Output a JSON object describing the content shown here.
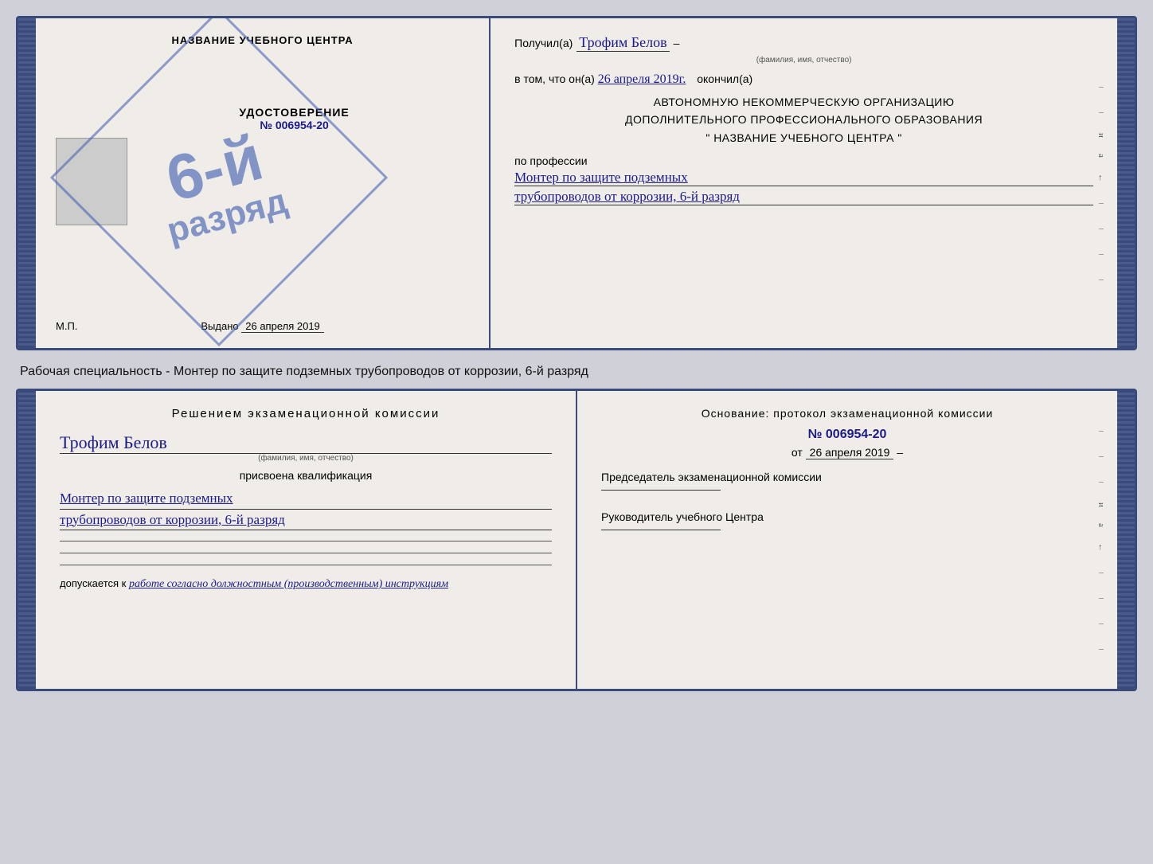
{
  "page": {
    "background": "#d0d0d8"
  },
  "top_certificate": {
    "left_page": {
      "institution_name": "НАЗВАНИЕ УЧЕБНОГО ЦЕНТРА",
      "udostoverenie_title": "УДОСТОВЕРЕНИЕ",
      "cert_number": "№ 006954-20",
      "stamp_lines": [
        "6-й",
        "разряд"
      ],
      "vydano_label": "Выдано",
      "vydano_date": "26 апреля 2019",
      "mp_label": "М.П."
    },
    "right_page": {
      "poluchil_label": "Получил(a)",
      "fio_value": "Трофим Белов",
      "fio_subtitle": "(фамилия, имя, отчество)",
      "dash": "–",
      "vtom_label": "в том, что он(а)",
      "date_value": "26 апреля 2019г.",
      "okonchil_label": "окончил(а)",
      "org_line1": "АВТОНОМНУЮ НЕКОММЕРЧЕСКУЮ ОРГАНИЗАЦИЮ",
      "org_line2": "ДОПОЛНИТЕЛЬНОГО ПРОФЕССИОНАЛЬНОГО ОБРАЗОВАНИЯ",
      "org_line3": "\" НАЗВАНИЕ УЧЕБНОГО ЦЕНТРА \"",
      "po_professii": "по профессии",
      "profession_line1": "Монтер по защите подземных",
      "profession_line2": "трубопроводов от коррозии, 6-й разряд"
    }
  },
  "caption": {
    "text": "Рабочая специальность - Монтер по защите подземных трубопроводов от коррозии, 6-й разряд"
  },
  "bottom_certificate": {
    "left_page": {
      "resheniem_title": "Решением экзаменационной комиссии",
      "fio_value": "Трофим Белов",
      "fio_subtitle": "(фамилия, имя, отчество)",
      "prisvoena_label": "присвоена квалификация",
      "qualification_line1": "Монтер по защите подземных",
      "qualification_line2": "трубопроводов от коррозии, 6-й разряд",
      "dopuskaetsya_label": "допускается к",
      "dopuskaetsya_value": "работе согласно должностным (производственным) инструкциям"
    },
    "right_page": {
      "osnovanie_title": "Основание: протокол экзаменационной комиссии",
      "number_label": "№",
      "number_value": "006954-20",
      "ot_label": "от",
      "ot_date": "26 апреля 2019",
      "chairman_title": "Председатель экзаменационной комиссии",
      "rukovoditel_title": "Руководитель учебного Центра"
    }
  }
}
